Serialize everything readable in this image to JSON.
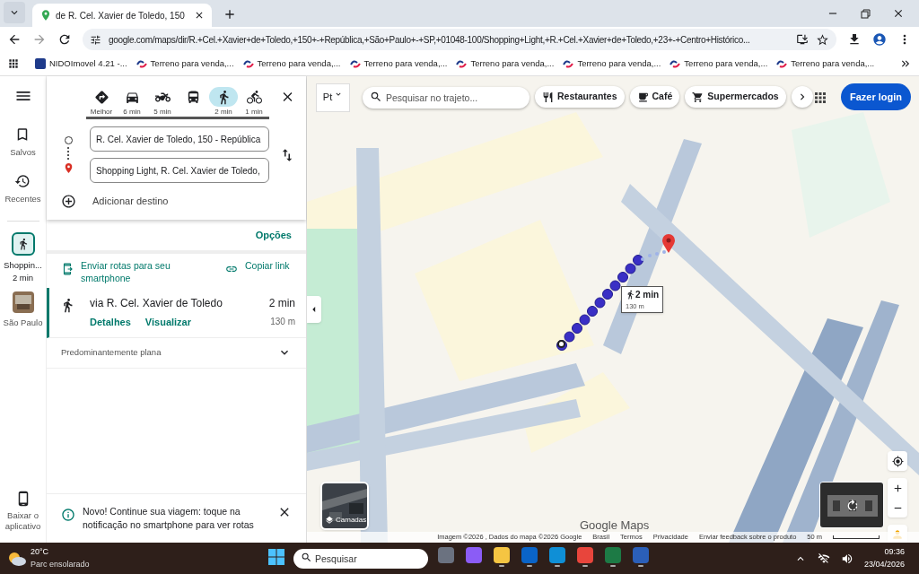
{
  "browser": {
    "tab": {
      "title": "de R. Cel. Xavier de Toledo, 150"
    },
    "url": "google.com/maps/dir/R.+Cel.+Xavier+de+Toledo,+150+-+República,+São+Paulo+-+SP,+01048-100/Shopping+Light,+R.+Cel.+Xavier+de+Toledo,+23+-+Centro+Histórico...",
    "bookmarks": [
      {
        "label": "NIDOImovel 4.21 -...",
        "kind": "nido"
      },
      {
        "label": "Terreno para venda,...",
        "kind": "terreno"
      },
      {
        "label": "Terreno para venda,...",
        "kind": "terreno"
      },
      {
        "label": "Terreno para venda,...",
        "kind": "terreno"
      },
      {
        "label": "Terreno para venda,...",
        "kind": "terreno"
      },
      {
        "label": "Terreno para venda,...",
        "kind": "terreno"
      },
      {
        "label": "Terreno para venda,...",
        "kind": "terreno"
      },
      {
        "label": "Terreno para venda,...",
        "kind": "terreno"
      }
    ]
  },
  "rail": {
    "items": [
      {
        "label": "Salvos",
        "kind": "saved"
      },
      {
        "label": "Recentes",
        "kind": "recent"
      }
    ],
    "trip": {
      "title": "Shoppin...",
      "time": "2 min"
    },
    "place": {
      "label": "São Paulo"
    },
    "download": "Baixar o aplicativo"
  },
  "modes": [
    {
      "kind": "best",
      "label": "Melhor",
      "selected": false
    },
    {
      "kind": "car",
      "label": "6 min",
      "selected": false
    },
    {
      "kind": "moto",
      "label": "5 min",
      "selected": false
    },
    {
      "kind": "transit",
      "selected": false
    },
    {
      "kind": "walk",
      "label": "2 min",
      "selected": true
    },
    {
      "kind": "bike",
      "label": "1 min",
      "selected": false
    }
  ],
  "origin": "R. Cel. Xavier de Toledo, 150 - República",
  "destination": "Shopping Light, R. Cel. Xavier de Toledo,",
  "add_destination": "Adicionar destino",
  "options": "Opções",
  "send": "Enviar rotas para seu smartphone",
  "copy": "Copiar link",
  "route": {
    "via": "via R. Cel. Xavier de Toledo",
    "duration": "2 min",
    "distance": "130 m",
    "links": [
      "Detalhes",
      "Visualizar"
    ],
    "selected": true
  },
  "terrain": "Predominantemente plana",
  "notice": "Novo! Continue sua viagem: toque na notificação no smartphone para ver rotas",
  "map": {
    "layer_button": "Pt",
    "search_placeholder": "Pesquisar no trajeto...",
    "chips": [
      {
        "label": "Restaurantes",
        "kind": "food"
      },
      {
        "label": "Café",
        "kind": "cafe"
      },
      {
        "label": "Supermercados",
        "kind": "cart"
      }
    ],
    "login": "Fazer login",
    "callout": {
      "time": "2 min",
      "distance": "130 m"
    },
    "layers": "Camadas",
    "logo": "Google Maps",
    "attribution": [
      "Imagem ©2026 , Dados do mapa ©2026 Google",
      "Brasil",
      "Termos",
      "Privacidade",
      "Enviar feedback sobre o produto"
    ],
    "scale": "50 m"
  },
  "taskbar": {
    "weather": {
      "temp": "20°C",
      "desc": "Parc ensolarado"
    },
    "search_placeholder": "Pesquisar",
    "time": "09:36",
    "date": "23/04/2026",
    "apps": [
      {
        "kind": "calculator",
        "running": false
      },
      {
        "kind": "copilot",
        "running": false
      },
      {
        "kind": "folder",
        "running": true
      },
      {
        "kind": "outlook",
        "running": true
      },
      {
        "kind": "edge",
        "running": true
      },
      {
        "kind": "chrome",
        "running": true
      },
      {
        "kind": "excel",
        "running": true
      },
      {
        "kind": "word",
        "running": true
      }
    ]
  }
}
